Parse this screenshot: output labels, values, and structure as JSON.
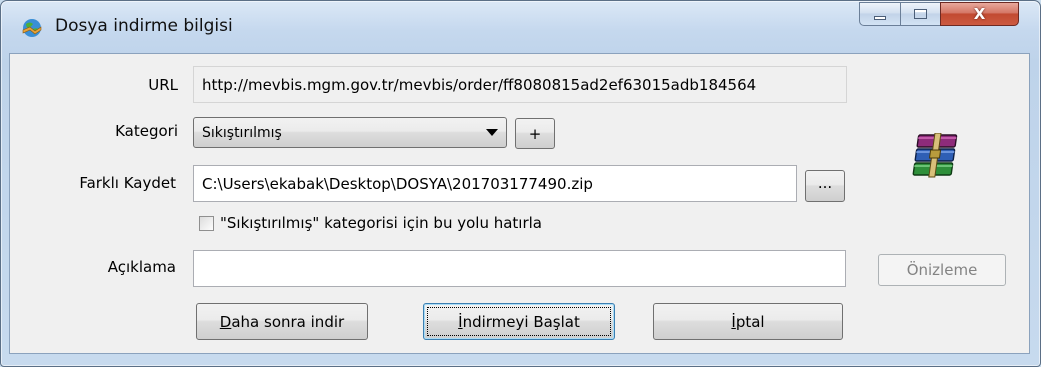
{
  "window": {
    "title": "Dosya indirme bilgisi",
    "controls": {
      "minimize": "minimize",
      "maximize": "maximize",
      "close": "X"
    }
  },
  "form": {
    "url_label": "URL",
    "url_value": "http://mevbis.mgm.gov.tr/mevbis/order/ff8080815ad2ef63015adb184564",
    "category_label": "Kategori",
    "category_value": "Sıkıştırılmış",
    "add_category_label": "+",
    "save_as_label": "Farklı Kaydet",
    "save_as_value": "C:\\Users\\ekabak\\Desktop\\DOSYA\\201703177490.zip",
    "browse_label": "...",
    "remember_path_label": "\"Sıkıştırılmış\" kategorisi için bu yolu hatırla",
    "remember_path_checked": false,
    "description_label": "Açıklama",
    "description_value": "",
    "preview_label": "Önizleme"
  },
  "buttons": {
    "later_prefix": "D",
    "later_rest": "aha sonra indir",
    "start_prefix": "İ",
    "start_rest": "ndirmeyi Başlat",
    "cancel_prefix": "İ",
    "cancel_rest": "ptal"
  },
  "icons": {
    "app": "idm-globe-icon",
    "archive": "winrar-archive-icon"
  }
}
